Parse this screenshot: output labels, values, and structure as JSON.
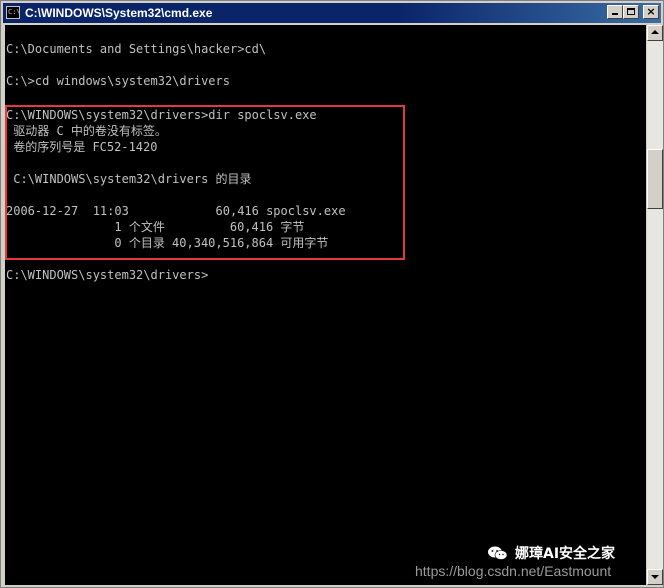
{
  "window": {
    "title": "C:\\WINDOWS\\System32\\cmd.exe",
    "icon_label": "C:\\",
    "buttons": {
      "minimize": "minimize",
      "maximize": "maximize",
      "close": "×"
    }
  },
  "console": {
    "lines": [
      "",
      "C:\\Documents and Settings\\hacker>cd\\",
      "",
      "C:\\>cd windows\\system32\\drivers",
      "",
      "C:\\WINDOWS\\system32\\drivers>dir spoclsv.exe",
      " 驱动器 C 中的卷没有标签。",
      " 卷的序列号是 FC52-1420",
      "",
      " C:\\WINDOWS\\system32\\drivers 的目录",
      "",
      "2006-12-27  11:03            60,416 spoclsv.exe",
      "               1 个文件         60,416 字节",
      "               0 个目录 40,340,516,864 可用字节",
      "",
      "C:\\WINDOWS\\system32\\drivers>"
    ],
    "highlight_color": "#e03a3a"
  },
  "watermark": {
    "name": "娜璋AI安全之家",
    "url": "https://blog.csdn.net/Eastmount"
  },
  "colors": {
    "titlebar": "#0a246a",
    "console_bg": "#000000",
    "console_text": "#c0c0c0"
  }
}
